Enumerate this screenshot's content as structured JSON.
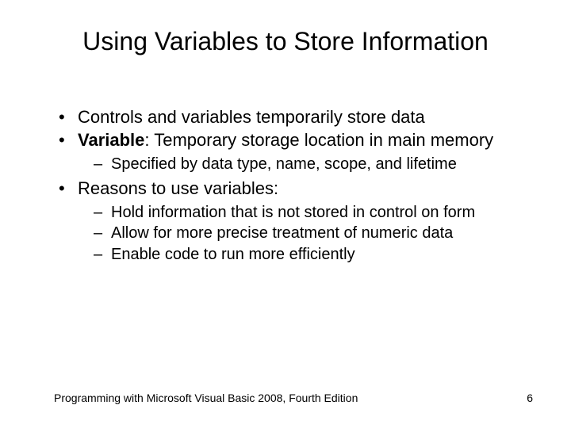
{
  "title": "Using Variables to Store Information",
  "bullets": {
    "b1": "Controls and variables temporarily store data",
    "b2_strong": "Variable",
    "b2_rest": ": Temporary storage location in main memory",
    "b2_sub1": "Specified by data type, name, scope, and lifetime",
    "b3": "Reasons to use variables:",
    "b3_sub1": "Hold information that is not stored in control on form",
    "b3_sub2": "Allow for more precise treatment of numeric data",
    "b3_sub3": "Enable code to run more efficiently"
  },
  "footer": {
    "left": "Programming with Microsoft Visual Basic 2008, Fourth Edition",
    "page": "6"
  }
}
